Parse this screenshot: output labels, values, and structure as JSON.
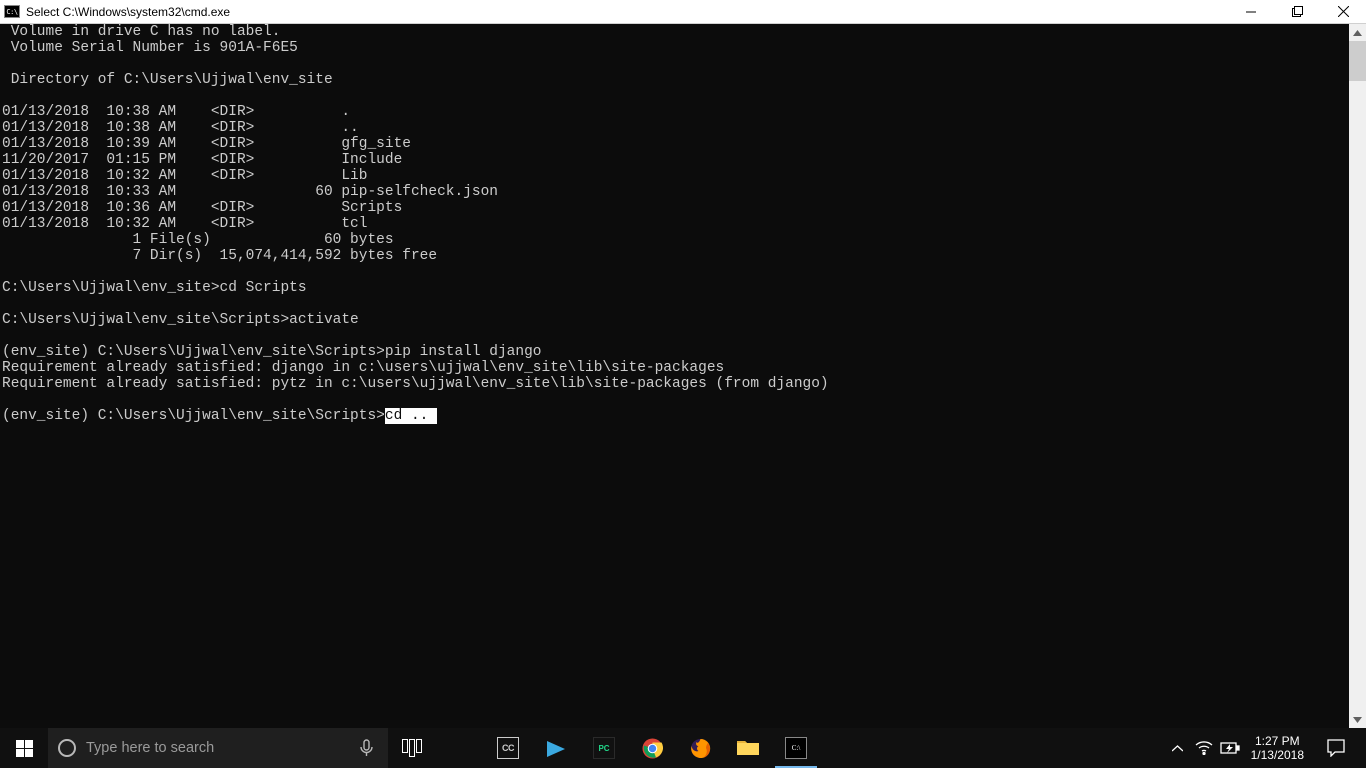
{
  "window": {
    "icon_label": "C:\\",
    "title": "Select C:\\Windows\\system32\\cmd.exe"
  },
  "terminal": {
    "lines": [
      " Volume in drive C has no label.",
      " Volume Serial Number is 901A-F6E5",
      "",
      " Directory of C:\\Users\\Ujjwal\\env_site",
      "",
      "01/13/2018  10:38 AM    <DIR>          .",
      "01/13/2018  10:38 AM    <DIR>          ..",
      "01/13/2018  10:39 AM    <DIR>          gfg_site",
      "11/20/2017  01:15 PM    <DIR>          Include",
      "01/13/2018  10:32 AM    <DIR>          Lib",
      "01/13/2018  10:33 AM                60 pip-selfcheck.json",
      "01/13/2018  10:36 AM    <DIR>          Scripts",
      "01/13/2018  10:32 AM    <DIR>          tcl",
      "               1 File(s)             60 bytes",
      "               7 Dir(s)  15,074,414,592 bytes free",
      "",
      "C:\\Users\\Ujjwal\\env_site>cd Scripts",
      "",
      "C:\\Users\\Ujjwal\\env_site\\Scripts>activate",
      "",
      "(env_site) C:\\Users\\Ujjwal\\env_site\\Scripts>pip install django",
      "Requirement already satisfied: django in c:\\users\\ujjwal\\env_site\\lib\\site-packages",
      "Requirement already satisfied: pytz in c:\\users\\ujjwal\\env_site\\lib\\site-packages (from django)",
      ""
    ],
    "current_prompt": "(env_site) C:\\Users\\Ujjwal\\env_site\\Scripts>",
    "current_input_selection": "cd .."
  },
  "taskbar": {
    "search_placeholder": "Type here to search"
  },
  "tray": {
    "time": "1:27 PM",
    "date": "1/13/2018"
  }
}
